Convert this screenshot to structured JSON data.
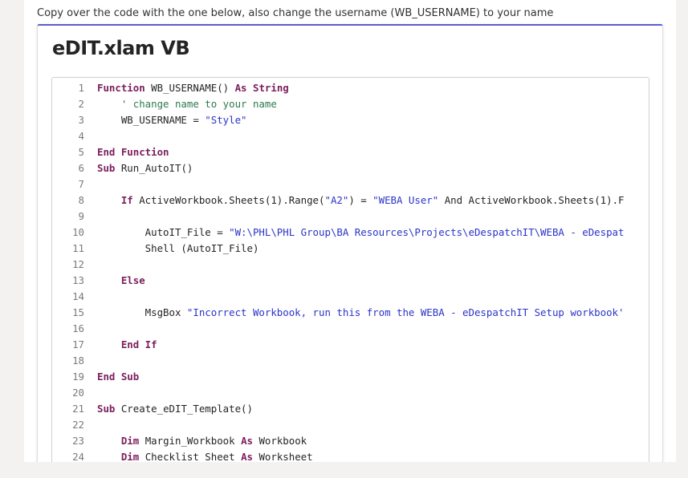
{
  "instruction": "Copy over the code with the one below, also change the username (WB_USERNAME) to your name",
  "card": {
    "title": "eDIT.xlam VB"
  },
  "code": {
    "lines": [
      {
        "n": "1",
        "tokens": [
          {
            "t": "Function",
            "c": "kw"
          },
          {
            "t": " WB_USERNAME() ",
            "c": "plain"
          },
          {
            "t": "As",
            "c": "kw"
          },
          {
            "t": " ",
            "c": "plain"
          },
          {
            "t": "String",
            "c": "kw"
          }
        ]
      },
      {
        "n": "2",
        "tokens": [
          {
            "t": "    ' change name to your name",
            "c": "cmt"
          }
        ]
      },
      {
        "n": "3",
        "tokens": [
          {
            "t": "    WB_USERNAME = ",
            "c": "plain"
          },
          {
            "t": "\"Style\"",
            "c": "str"
          }
        ]
      },
      {
        "n": "4",
        "tokens": []
      },
      {
        "n": "5",
        "tokens": [
          {
            "t": "End Function",
            "c": "kw"
          }
        ]
      },
      {
        "n": "6",
        "tokens": [
          {
            "t": "Sub",
            "c": "kw"
          },
          {
            "t": " Run_AutoIT()",
            "c": "plain"
          }
        ]
      },
      {
        "n": "7",
        "tokens": []
      },
      {
        "n": "8",
        "tokens": [
          {
            "t": "    ",
            "c": "plain"
          },
          {
            "t": "If",
            "c": "kw"
          },
          {
            "t": " ActiveWorkbook.Sheets(1).Range(",
            "c": "plain"
          },
          {
            "t": "\"A2\"",
            "c": "str"
          },
          {
            "t": ") = ",
            "c": "plain"
          },
          {
            "t": "\"WEBA User\"",
            "c": "str"
          },
          {
            "t": " And ActiveWorkbook.Sheets(1).F",
            "c": "plain"
          }
        ]
      },
      {
        "n": "9",
        "tokens": []
      },
      {
        "n": "10",
        "tokens": [
          {
            "t": "        AutoIT_File = ",
            "c": "plain"
          },
          {
            "t": "\"W:\\PHL\\PHL Group\\BA Resources\\Projects\\eDespatchIT\\WEBA - eDespat",
            "c": "str"
          }
        ]
      },
      {
        "n": "11",
        "tokens": [
          {
            "t": "        Shell (AutoIT_File)",
            "c": "plain"
          }
        ]
      },
      {
        "n": "12",
        "tokens": []
      },
      {
        "n": "13",
        "tokens": [
          {
            "t": "    Else",
            "c": "kw"
          }
        ]
      },
      {
        "n": "14",
        "tokens": []
      },
      {
        "n": "15",
        "tokens": [
          {
            "t": "        MsgBox ",
            "c": "plain"
          },
          {
            "t": "\"Incorrect Workbook, run this from the WEBA - eDespatchIT Setup workbook'",
            "c": "str"
          }
        ]
      },
      {
        "n": "16",
        "tokens": []
      },
      {
        "n": "17",
        "tokens": [
          {
            "t": "    End If",
            "c": "kw"
          }
        ]
      },
      {
        "n": "18",
        "tokens": []
      },
      {
        "n": "19",
        "tokens": [
          {
            "t": "End Sub",
            "c": "kw"
          }
        ]
      },
      {
        "n": "20",
        "tokens": []
      },
      {
        "n": "21",
        "tokens": [
          {
            "t": "Sub",
            "c": "kw"
          },
          {
            "t": " Create_eDIT_Template()",
            "c": "plain"
          }
        ]
      },
      {
        "n": "22",
        "tokens": []
      },
      {
        "n": "23",
        "tokens": [
          {
            "t": "    ",
            "c": "plain"
          },
          {
            "t": "Dim",
            "c": "kw"
          },
          {
            "t": " Margin_Workbook ",
            "c": "plain"
          },
          {
            "t": "As",
            "c": "kw"
          },
          {
            "t": " Workbook",
            "c": "plain"
          }
        ]
      },
      {
        "n": "24",
        "tokens": [
          {
            "t": "    ",
            "c": "plain"
          },
          {
            "t": "Dim",
            "c": "kw"
          },
          {
            "t": " Checklist_Sheet ",
            "c": "plain"
          },
          {
            "t": "As",
            "c": "kw"
          },
          {
            "t": " Worksheet",
            "c": "plain"
          }
        ]
      }
    ]
  },
  "colors": {
    "accent": "#5b5fc7",
    "keyword": "#7a1f5c",
    "string": "#2b34c8",
    "comment": "#2f7a4f"
  }
}
